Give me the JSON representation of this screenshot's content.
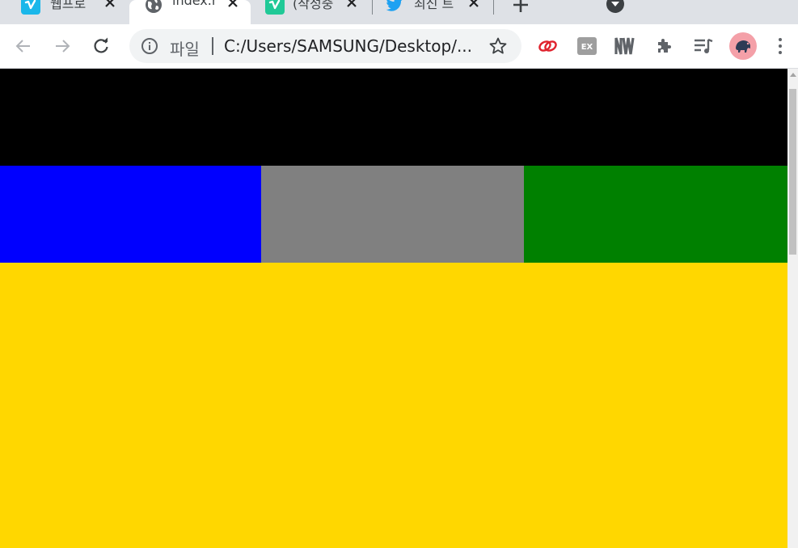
{
  "tabs": [
    {
      "title": "웹프로",
      "favicon": "vimeo-icon",
      "active": false
    },
    {
      "title": "index.h",
      "favicon": "globe-icon",
      "active": true
    },
    {
      "title": "(작성중",
      "favicon": "vimeo-icon",
      "active": false
    },
    {
      "title": "최신 트",
      "favicon": "twitter-icon",
      "active": false
    }
  ],
  "toolbar": {
    "scheme_label": "파일",
    "url": "C:/Users/SAMSUNG/Desktop/...",
    "extensions": [
      "creative-cloud-icon",
      "ex-extension-icon",
      "nw-extension-icon",
      "puzzle-icon",
      "reading-list-icon"
    ],
    "profile": "profile-avatar"
  },
  "colors": {
    "header": "#000000",
    "left_column": "#0000ff",
    "middle_column": "#808080",
    "right_column": "#008000",
    "body": "#ffd700"
  }
}
